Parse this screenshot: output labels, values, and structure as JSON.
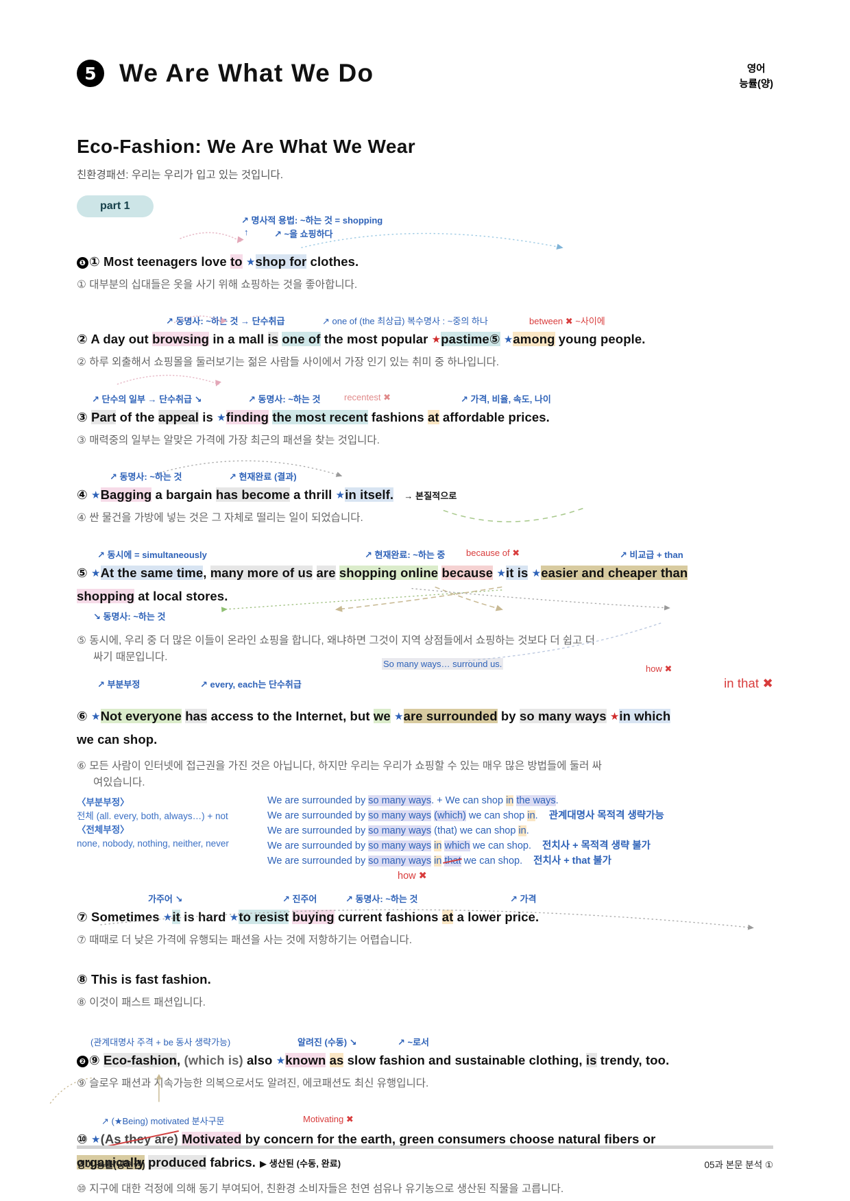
{
  "header": {
    "unit_number": "5",
    "unit_title": "We Are What We Do",
    "subject": "영어",
    "publisher": "능률(양)"
  },
  "doc": {
    "title": "Eco-Fashion: We Are What We Wear",
    "title_ko": "친환경패션: 우리는 우리가 입고 있는 것입니다.",
    "part_label": "part 1"
  },
  "sentences": [
    {
      "marker": "①",
      "bold_marker": "❶",
      "annotations": [
        "↗ 명사적 용법: ~하는 것 = shopping",
        "↑",
        "↗ ~을 쇼핑하다"
      ],
      "english": "Most teenagers love to ★shop for clothes.",
      "parts": {
        "plain1": "Most teenagers love ",
        "hl_pink": "to",
        "hl_blue": "shop for",
        "plain2": " clothes."
      },
      "korean": "① 대부분의 십대들은 옷을 사기 위해 쇼핑하는 것을 좋아합니다."
    },
    {
      "marker": "②",
      "annotations": [
        "↗ 동명사: ~하는 것 → 단수취급",
        "↗ one of (the 최상급) 복수명사 : ~중의 하나",
        "between ✖ ~사이에"
      ],
      "english": "A day out browsing in a mall is one of the most popular ★pastime⑤ ★among young people.",
      "korean": "② 하루 외출해서 쇼핑몰을 둘러보기는 젊은 사람들 사이에서 가장 인기 있는 취미 중 하나입니다."
    },
    {
      "marker": "③",
      "annotations": [
        "↗ 단수의 일부 → 단수취급 ↘",
        "↗ 동명사: ~하는 것",
        "recentest ✖",
        "↗ 가격, 비율, 속도, 나이"
      ],
      "english": "Part of the appeal is ★finding the most recent fashions at affordable prices.",
      "korean": "③ 매력중의 일부는 알맞은 가격에 가장 최근의 패션을 찾는 것입니다."
    },
    {
      "marker": "④",
      "annotations": [
        "↗ 동명사: ~하는 것",
        "↗ 현재완료 (결과)",
        "→ 본질적으로"
      ],
      "english": "★Bagging a bargain has become a thrill ★in itself.",
      "korean": "④ 싼 물건을 가방에 넣는 것은 그 자체로 떨리는 일이 되었습니다."
    },
    {
      "marker": "⑤",
      "annotations": [
        "↗ 동시에 = simultaneously",
        "↗ 현재완료: ~하는 중",
        "because of ✖",
        "↗ 비교급 + than",
        "↘ 동명사: ~하는 것"
      ],
      "english_line1": "★At the same time, many more of us are shopping online because ★it is ★easier and cheaper than",
      "english_line2": "shopping at local stores.",
      "korean_line1": "⑤ 동시에, 우리 중 더 많은 이들이 온라인 쇼핑을 합니다, 왜냐하면 그것이 지역 상점들에서 쇼핑하는 것보다 더 쉽고 더",
      "korean_line2": "싸기 때문입니다."
    },
    {
      "marker": "⑥",
      "annotations": [
        "↗ 부분부정",
        "↗ every, each는 단수취급",
        "So many ways… surround us.",
        "how ✖",
        "in that ✖"
      ],
      "english_line1": "★Not everyone has access to the Internet, but we ★are surrounded by so many ways ★in which",
      "english_line2": "we can shop.",
      "korean_line1": "⑥ 모든 사람이 인터넷에 접근권을 가진 것은 아닙니다, 하지만 우리는 우리가 쇼핑할 수 있는 매우 많은 방법들에 둘러 싸",
      "korean_line2": "여있습니다."
    },
    {
      "marker": "⑦",
      "annotations": [
        "가주어 ↘",
        "↗ 진주어",
        "↗ 동명사: ~하는 것",
        "↗ 가격"
      ],
      "english": "Sometimes ★it is hard ★to resist buying current fashions at a lower price.",
      "korean": "⑦ 때때로 더 낮은 가격에 유행되는 패션을 사는 것에 저항하기는 어렵습니다."
    },
    {
      "marker": "⑧",
      "annotations": [],
      "english": "This is fast fashion.",
      "korean": "⑧ 이것이 패스트 패션입니다."
    },
    {
      "marker": "⑨",
      "bold_marker": "❷",
      "annotations": [
        "(관계대명사 주격 + be 동사 생략가능)",
        "알려진 (수동) ↘",
        "↗ ~로서"
      ],
      "english": "Eco-fashion, (which is) also ★known as slow fashion and sustainable clothing, is trendy, too.",
      "korean": "⑨ 슬로우 패션과 지속가능한 의복으로서도 알려진, 에코패션도 최신 유행입니다."
    },
    {
      "marker": "⑩",
      "annotations": [
        "↗ (★Being) motivated 분사구문",
        "Motivating ✖",
        "▶ 생산된 (수동, 완료)"
      ],
      "english_line1": "★(As they are) Motivated by concern for the earth, green consumers choose natural fibers or",
      "english_line2": "organically produced fabrics.",
      "korean": "⑩ 지구에 대한 걱정에 의해 동기 부여되어, 친환경 소비자들은 천연 섬유나 유기농으로 생산된 직물을 고릅니다."
    }
  ],
  "explanation_box": {
    "lines": [
      {
        "text_a": "We are surrounded by ",
        "hl": "so many ways",
        "text_b": ". + We can shop ",
        "hl2": "in",
        "text_c": " ",
        "hl3": "the ways",
        "text_d": ".",
        "note": ""
      },
      {
        "text_a": "We are surrounded by ",
        "hl": "so many ways",
        "text_b": " ",
        "hl2": "(which)",
        "text_c": " we can shop ",
        "hl3": "in",
        "text_d": ".",
        "note": "관계대명사 목적격 생략가능"
      },
      {
        "text_a": "We are surrounded by ",
        "hl": "so many ways",
        "text_b": " (that) we can shop ",
        "hl2": "in",
        "text_c": "",
        "hl3": "",
        "text_d": ".",
        "note": ""
      },
      {
        "text_a": "We are surrounded by ",
        "hl": "so many ways",
        "text_b": " ",
        "hl2": "in",
        "text_c": " ",
        "hl3": "which",
        "text_d": " we can shop.",
        "note": "전치사 + 목적격 생략 불가"
      },
      {
        "text_a": "We are surrounded by ",
        "hl": "so many ways",
        "text_b": " ",
        "hl2": "in",
        "text_c": " ",
        "hl3": "that",
        "text_d": " we can shop.",
        "note": "전치사 + that 불가"
      }
    ],
    "how_x": "how ✖"
  },
  "side_note": {
    "line1": "〈부분부정〉",
    "line2": "전체 (all. every, both, always…) + not",
    "line3": "〈전체부정〉",
    "line4": "none, nobody, nothing, neither, never"
  },
  "footer": {
    "left": "영어 능률(양현권)",
    "right": "05과 본문 분석 ①"
  },
  "colors": {
    "accent_blue": "#2e62b8",
    "red": "#cf2a2a",
    "chip_bg": "#cde5e7",
    "korean_gray": "#666666"
  }
}
